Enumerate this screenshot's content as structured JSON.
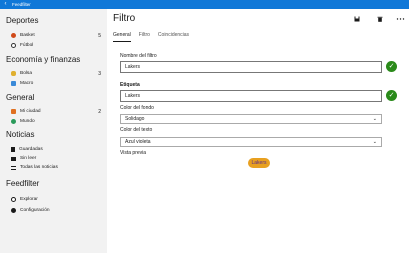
{
  "app": {
    "title": "Feedfilter",
    "back_icon": "‹"
  },
  "sidebar": {
    "categories": [
      {
        "label": "Deportes",
        "items": [
          {
            "label": "Basket",
            "count": "5",
            "icon": "basketball-icon"
          },
          {
            "label": "Fútbol",
            "count": "",
            "icon": "soccer-ball-icon"
          }
        ]
      },
      {
        "label": "Economía y finanzas",
        "items": [
          {
            "label": "Bolsa",
            "count": "3",
            "icon": "money-bag-icon"
          },
          {
            "label": "Macro",
            "count": "",
            "icon": "chart-icon"
          }
        ]
      },
      {
        "label": "General",
        "items": [
          {
            "label": "Mi ciudad",
            "count": "2",
            "icon": "city-icon"
          },
          {
            "label": "Mundo",
            "count": "",
            "icon": "globe-icon"
          }
        ]
      },
      {
        "label": "Noticias",
        "items": [
          {
            "label": "Guardadas",
            "icon": "bookmark-icon"
          },
          {
            "label": "Sin leer",
            "icon": "envelope-icon"
          },
          {
            "label": "Todas las noticias",
            "icon": "list-icon"
          }
        ]
      },
      {
        "label": "Feedfilter",
        "items": [
          {
            "label": "Explorar",
            "icon": "compass-icon"
          },
          {
            "label": "Configuración",
            "icon": "gear-icon"
          }
        ]
      }
    ]
  },
  "main": {
    "title": "Filtro",
    "commands": {
      "save": "save-icon",
      "delete": "trash-icon",
      "more": "more-icon"
    },
    "tabs": [
      "General",
      "Filtro",
      "Coincidencias"
    ],
    "active_tab": "General",
    "form": {
      "name_label": "Nombre del filtro",
      "name_value": "Lakers",
      "tag_label": "Etiqueta",
      "tag_value": "Lakers",
      "bg_label": "Color del fondo",
      "bg_value": "Solidago",
      "text_label": "Color del texto",
      "text_value": "Azul violeta",
      "preview_label": "Vista previa",
      "preview_text": "Lakers"
    }
  },
  "colors": {
    "accent": "#1078d8",
    "valid": "#2a8a1a",
    "preview_bg": "#e8a020",
    "preview_fg": "#5a2a8a"
  }
}
